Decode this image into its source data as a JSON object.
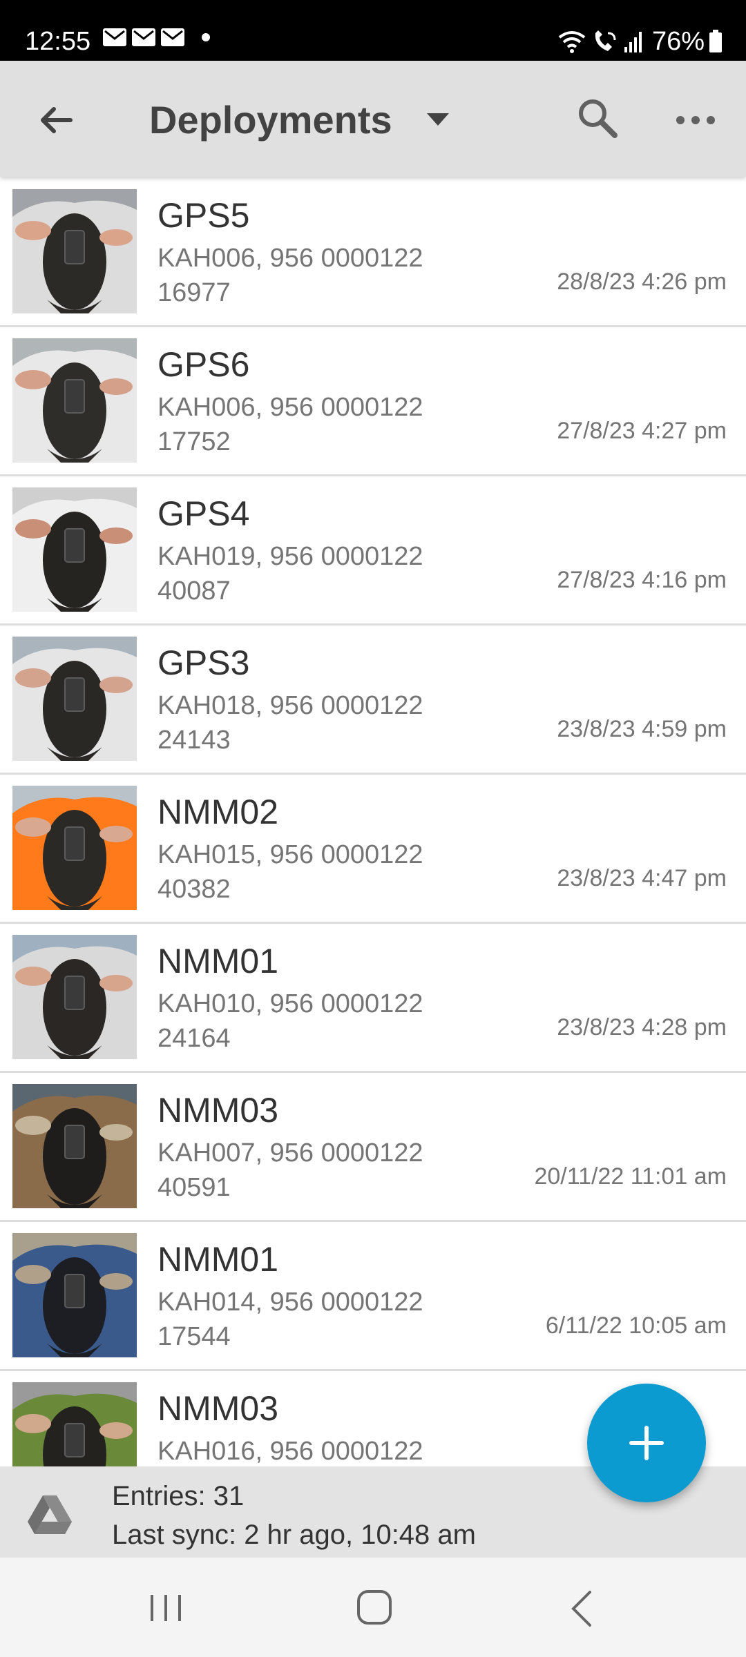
{
  "status_bar": {
    "time": "12:55",
    "battery": "76%",
    "notification_icons": [
      "mail-icon",
      "mail-icon",
      "mail-icon",
      "dot-icon"
    ],
    "system_icons": [
      "wifi-icon",
      "wifi-calling-icon",
      "signal-icon",
      "battery-icon"
    ]
  },
  "app_bar": {
    "title": "Deployments",
    "icons": [
      "back-arrow-icon",
      "chevron-down-icon",
      "search-icon",
      "more-icon"
    ]
  },
  "deployments": [
    {
      "title": "GPS5",
      "subtitle": "KAH006, 956 0000122",
      "subtitle2": "16977",
      "date": "28/8/23 4:26 pm"
    },
    {
      "title": "GPS6",
      "subtitle": "KAH006, 956 0000122",
      "subtitle2": "17752",
      "date": "27/8/23 4:27 pm"
    },
    {
      "title": "GPS4",
      "subtitle": "KAH019, 956 0000122",
      "subtitle2": "40087",
      "date": "27/8/23 4:16 pm"
    },
    {
      "title": "GPS3",
      "subtitle": "KAH018, 956 0000122",
      "subtitle2": "24143",
      "date": "23/8/23 4:59 pm"
    },
    {
      "title": "NMM02",
      "subtitle": "KAH015, 956 0000122",
      "subtitle2": "40382",
      "date": "23/8/23 4:47 pm"
    },
    {
      "title": "NMM01",
      "subtitle": "KAH010, 956 0000122",
      "subtitle2": "24164",
      "date": "23/8/23 4:28 pm"
    },
    {
      "title": "NMM03",
      "subtitle": "KAH007, 956 0000122",
      "subtitle2": "40591",
      "date": "20/11/22 11:01 am"
    },
    {
      "title": "NMM01",
      "subtitle": "KAH014, 956 0000122",
      "subtitle2": "17544",
      "date": "6/11/22 10:05 am"
    },
    {
      "title": "NMM03",
      "subtitle": "KAH016, 956 0000122",
      "subtitle2": "",
      "date": ""
    }
  ],
  "sync": {
    "entries": "Entries: 31",
    "last_sync": "Last sync: 2 hr ago, 10:48 am"
  },
  "colors": {
    "app_bar": "#e0e0e0",
    "fab": "#0c9bd1",
    "sync_bar": "#e3e3e3"
  }
}
